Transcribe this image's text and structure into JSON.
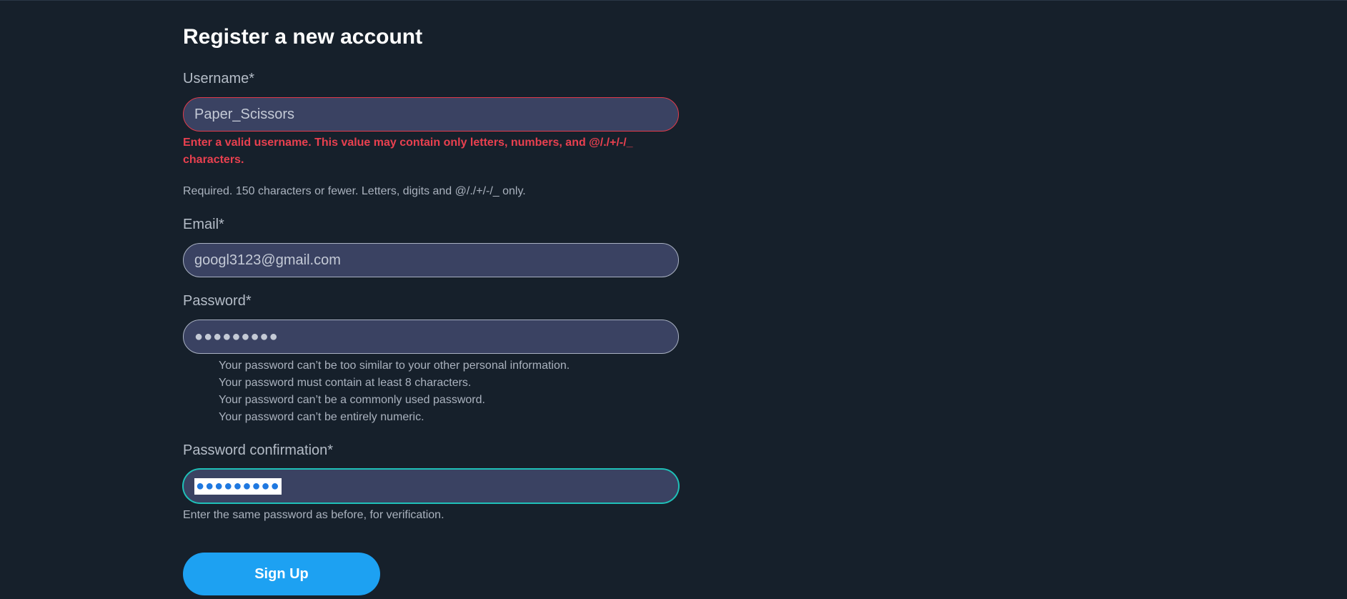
{
  "page": {
    "title": "Register a new account"
  },
  "username": {
    "label": "Username*",
    "value": "Paper_Scissors",
    "error": "Enter a valid username. This value may contain only letters, numbers, and @/./+/-/_ characters.",
    "help": "Required. 150 characters or fewer. Letters, digits and @/./+/-/_ only."
  },
  "email": {
    "label": "Email*",
    "value": "googl3123@gmail.com"
  },
  "password": {
    "label": "Password*",
    "masked": "●●●●●●●●●",
    "rules": [
      "Your password can’t be too similar to your other personal information.",
      "Your password must contain at least 8 characters.",
      "Your password can’t be a commonly used password.",
      "Your password can’t be entirely numeric."
    ]
  },
  "password_confirm": {
    "label": "Password confirmation*",
    "masked": "●●●●●●●●●",
    "help": "Enter the same password as before, for verification."
  },
  "submit": {
    "label": "Sign Up"
  },
  "colors": {
    "background": "#16202b",
    "input_bg": "#3a4262",
    "error": "#e8404f",
    "focus": "#1fc0b8",
    "button": "#1da1f2"
  }
}
